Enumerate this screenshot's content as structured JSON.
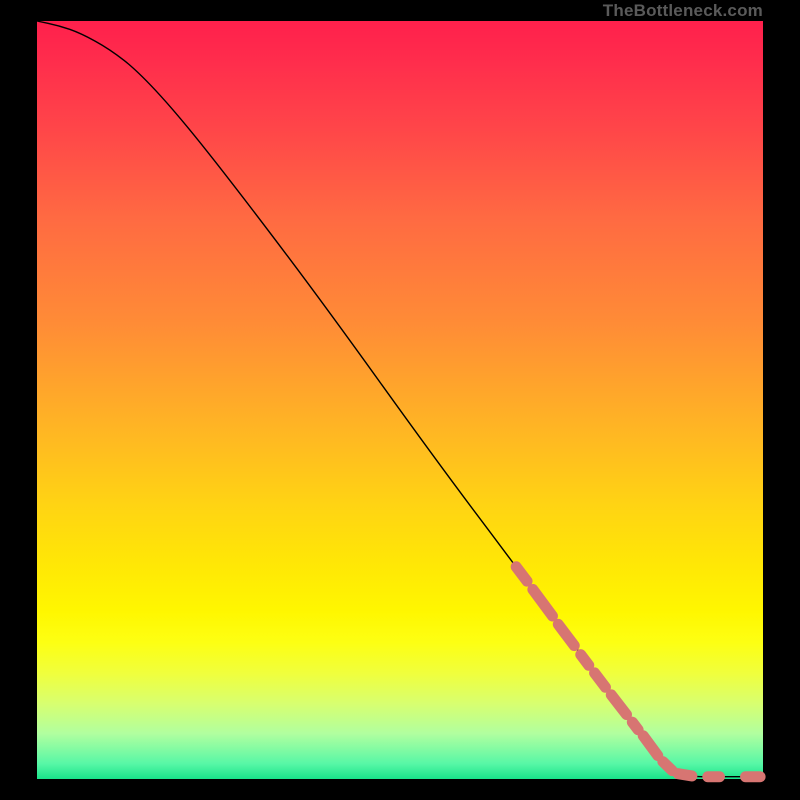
{
  "watermark": "TheBottleneck.com",
  "colors": {
    "dash": "#d77572",
    "curve": "#000000",
    "bg_black": "#000000",
    "gradient_top": "#ff204c",
    "gradient_bottom": "#19e38a"
  },
  "chart_data": {
    "type": "line",
    "title": "",
    "xlabel": "",
    "ylabel": "",
    "xlim": [
      0,
      100
    ],
    "ylim": [
      0,
      100
    ],
    "grid": false,
    "legend": false,
    "curve": [
      {
        "x": 0,
        "y": 100
      },
      {
        "x": 3,
        "y": 99.4
      },
      {
        "x": 6,
        "y": 98.4
      },
      {
        "x": 10,
        "y": 96.3
      },
      {
        "x": 14,
        "y": 93.3
      },
      {
        "x": 20,
        "y": 87.0
      },
      {
        "x": 29,
        "y": 76.0
      },
      {
        "x": 40,
        "y": 62.0
      },
      {
        "x": 55,
        "y": 42.0
      },
      {
        "x": 66,
        "y": 28.0
      },
      {
        "x": 76,
        "y": 15.0
      },
      {
        "x": 84,
        "y": 5.0
      },
      {
        "x": 88,
        "y": 1.0
      },
      {
        "x": 90,
        "y": 0.3
      },
      {
        "x": 94,
        "y": 0.3
      },
      {
        "x": 100,
        "y": 0.3
      }
    ],
    "dash_segments": [
      {
        "x1": 66.0,
        "y1": 28.0,
        "x2": 67.5,
        "y2": 26.1
      },
      {
        "x1": 68.3,
        "y1": 25.0,
        "x2": 71.0,
        "y2": 21.5
      },
      {
        "x1": 71.8,
        "y1": 20.4,
        "x2": 74.0,
        "y2": 17.6
      },
      {
        "x1": 74.9,
        "y1": 16.4,
        "x2": 76.0,
        "y2": 15.0
      },
      {
        "x1": 76.8,
        "y1": 14.0,
        "x2": 78.3,
        "y2": 12.1
      },
      {
        "x1": 79.1,
        "y1": 11.1,
        "x2": 81.2,
        "y2": 8.5
      },
      {
        "x1": 82.0,
        "y1": 7.5,
        "x2": 82.8,
        "y2": 6.5
      },
      {
        "x1": 83.5,
        "y1": 5.7,
        "x2": 85.5,
        "y2": 3.1
      },
      {
        "x1": 86.2,
        "y1": 2.3,
        "x2": 87.5,
        "y2": 1.1
      },
      {
        "x1": 88.3,
        "y1": 0.7,
        "x2": 90.2,
        "y2": 0.4
      },
      {
        "x1": 92.4,
        "y1": 0.3,
        "x2": 94.0,
        "y2": 0.3
      },
      {
        "x1": 97.6,
        "y1": 0.3,
        "x2": 99.6,
        "y2": 0.3
      }
    ]
  }
}
